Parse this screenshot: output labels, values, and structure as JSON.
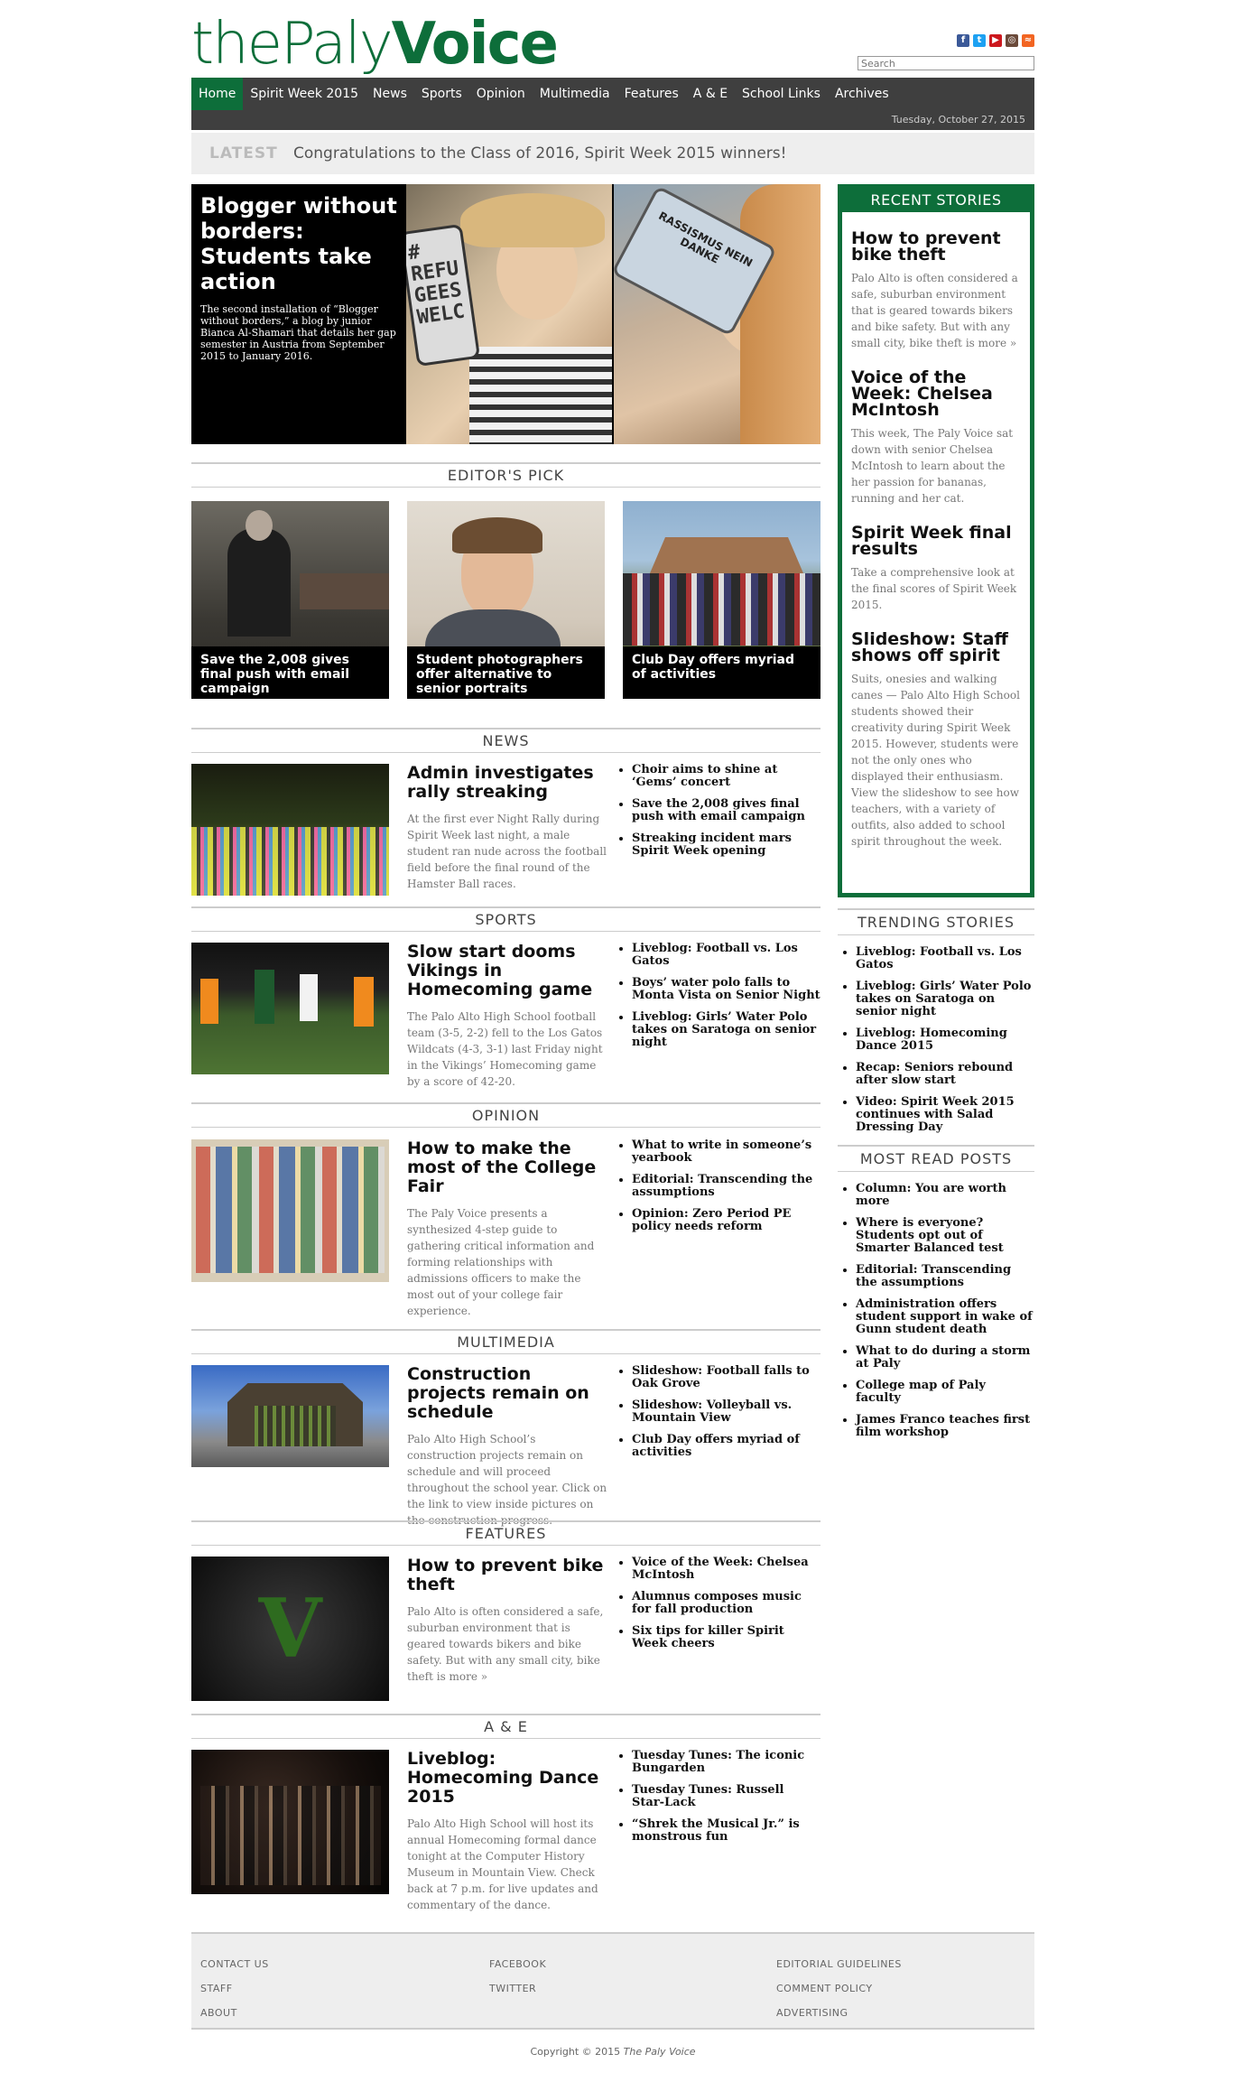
{
  "logo": {
    "the": "the",
    "paly": "Paly",
    "voice": "Voice"
  },
  "search": {
    "placeholder": "Search"
  },
  "social": [
    "facebook-icon",
    "twitter-icon",
    "youtube-icon",
    "instagram-icon",
    "rss-icon"
  ],
  "nav": [
    "Home",
    "Spirit Week 2015",
    "News",
    "Sports",
    "Opinion",
    "Multimedia",
    "Features",
    "A & E",
    "School Links",
    "Archives"
  ],
  "date": "Tuesday, October 27, 2015",
  "latest": {
    "label": "LATEST",
    "text": "Congratulations to the Class of 2016, Spirit Week 2015 winners!"
  },
  "hero": {
    "title": "Blogger without borders: Students take action",
    "sub": "The second installation of “Blogger without borders,” a blog by junior Bianca Al-Shamari that details her gap semester in Austria from September 2015 to January 2016.",
    "phone1": "# REFU GEES WELC",
    "phone2": "RASSISMUS NEIN DANKE"
  },
  "editors": {
    "title": "EDITOR'S PICK",
    "items": [
      "Save the 2,008 gives final push with email campaign",
      "Student photographers offer alternative to senior portraits",
      "Club Day offers myriad of activities"
    ]
  },
  "sections": {
    "news": {
      "title": "NEWS",
      "headline": "Admin investigates rally streaking",
      "text": "At the first ever Night Rally during Spirit Week last night, a male student ran nude across the football field before the final round of the Hamster Ball races.",
      "links": [
        "Choir aims to shine at ‘Gems’ concert",
        "Save the 2,008 gives final push with email campaign",
        "Streaking incident mars Spirit Week opening"
      ]
    },
    "sports": {
      "title": "SPORTS",
      "headline": "Slow start dooms Vikings in Homecoming game",
      "text": "The Palo Alto High School football team (3-5, 2-2) fell to the Los Gatos Wildcats (4-3, 3-1) last Friday night in the Vikings’ Homecoming game by a score of 42-20.",
      "links": [
        "Liveblog: Football vs. Los Gatos",
        "Boys’ water polo falls to Monta Vista on Senior Night",
        "Liveblog: Girls’ Water Polo takes on Saratoga on senior night"
      ]
    },
    "opinion": {
      "title": "OPINION",
      "headline": "How to make the most of the College Fair",
      "text": "The Paly Voice presents a synthesized 4-step guide to gathering critical information and forming relationships with admissions officers to make the most out of your college fair experience.",
      "links": [
        "What to write in someone’s yearbook",
        "Editorial: Transcending the assumptions",
        "Opinion: Zero Period PE policy needs reform"
      ]
    },
    "multimedia": {
      "title": "MULTIMEDIA",
      "headline": "Construction projects remain on schedule",
      "text": "Palo Alto High School’s construction projects remain on schedule and will proceed throughout the school year. Click on the link to view inside pictures on the construction progress.",
      "links": [
        "Slideshow: Football falls to Oak Grove",
        "Slideshow: Volleyball vs. Mountain View",
        "Club Day offers myriad of activities"
      ]
    },
    "features": {
      "title": "FEATURES",
      "headline": "How to prevent bike theft",
      "text": "Palo Alto is often considered a safe, suburban environment that is geared towards bikers and bike safety. But with any small city, bike theft is more »",
      "links": [
        "Voice of the Week: Chelsea McIntosh",
        "Alumnus composes music for fall production",
        "Six tips for killer Spirit Week cheers"
      ]
    },
    "ae": {
      "title": "A & E",
      "headline": "Liveblog: Homecoming Dance 2015",
      "text": "Palo Alto High School will host its annual Homecoming formal dance tonight at the Computer History Museum in Mountain View. Check back at 7 p.m. for live updates and commentary of the dance.",
      "links": [
        "Tuesday Tunes: The iconic Bungarden",
        "Tuesday Tunes: Russell Star-Lack",
        "“Shrek the Musical Jr.” is monstrous fun"
      ]
    }
  },
  "features_logo": "V",
  "recent": {
    "title": "RECENT STORIES",
    "items": [
      {
        "t": "How to prevent bike theft",
        "d": "Palo Alto is often considered a safe, suburban environment that is geared towards bikers and bike safety. But with any small city, bike theft is more »"
      },
      {
        "t": "Voice of the Week: Chelsea McIntosh",
        "d": "This week, The Paly Voice sat down with senior Chelsea McIntosh to learn about the her passion for bananas, running and her cat."
      },
      {
        "t": "Spirit Week final results",
        "d": "Take a comprehensive look at the final scores of Spirit Week 2015."
      },
      {
        "t": "Slideshow: Staff shows off spirit",
        "d": "Suits, onesies and walking canes — Palo Alto High School students showed their creativity during Spirit Week 2015. However, students were not the only ones who displayed their enthusiasm. View the slideshow to see how teachers, with a variety of outfits, also added to school spirit throughout the week."
      }
    ]
  },
  "trending": {
    "title": "TRENDING STORIES",
    "items": [
      "Liveblog: Football vs. Los Gatos",
      "Liveblog: Girls’ Water Polo takes on Saratoga on senior night",
      "Liveblog: Homecoming Dance 2015",
      "Recap: Seniors rebound after slow start",
      "Video: Spirit Week 2015 continues with Salad Dressing Day"
    ]
  },
  "mostread": {
    "title": "MOST READ POSTS",
    "items": [
      "Column: You are worth more",
      "Where is everyone? Students opt out of Smarter Balanced test",
      "Editorial: Transcending the assumptions",
      "Administration offers student support in wake of Gunn student death",
      "What to do during a storm at Paly",
      "College map of Paly faculty",
      "James Franco teaches first film workshop"
    ]
  },
  "footer": {
    "col1": [
      "CONTACT US",
      "STAFF",
      "ABOUT"
    ],
    "col2": [
      "FACEBOOK",
      "TWITTER"
    ],
    "col3": [
      "EDITORIAL GUIDELINES",
      "COMMENT POLICY",
      "ADVERTISING"
    ],
    "copyright_prefix": "Copyright © 2015 ",
    "copyright_name": "The Paly Voice"
  }
}
